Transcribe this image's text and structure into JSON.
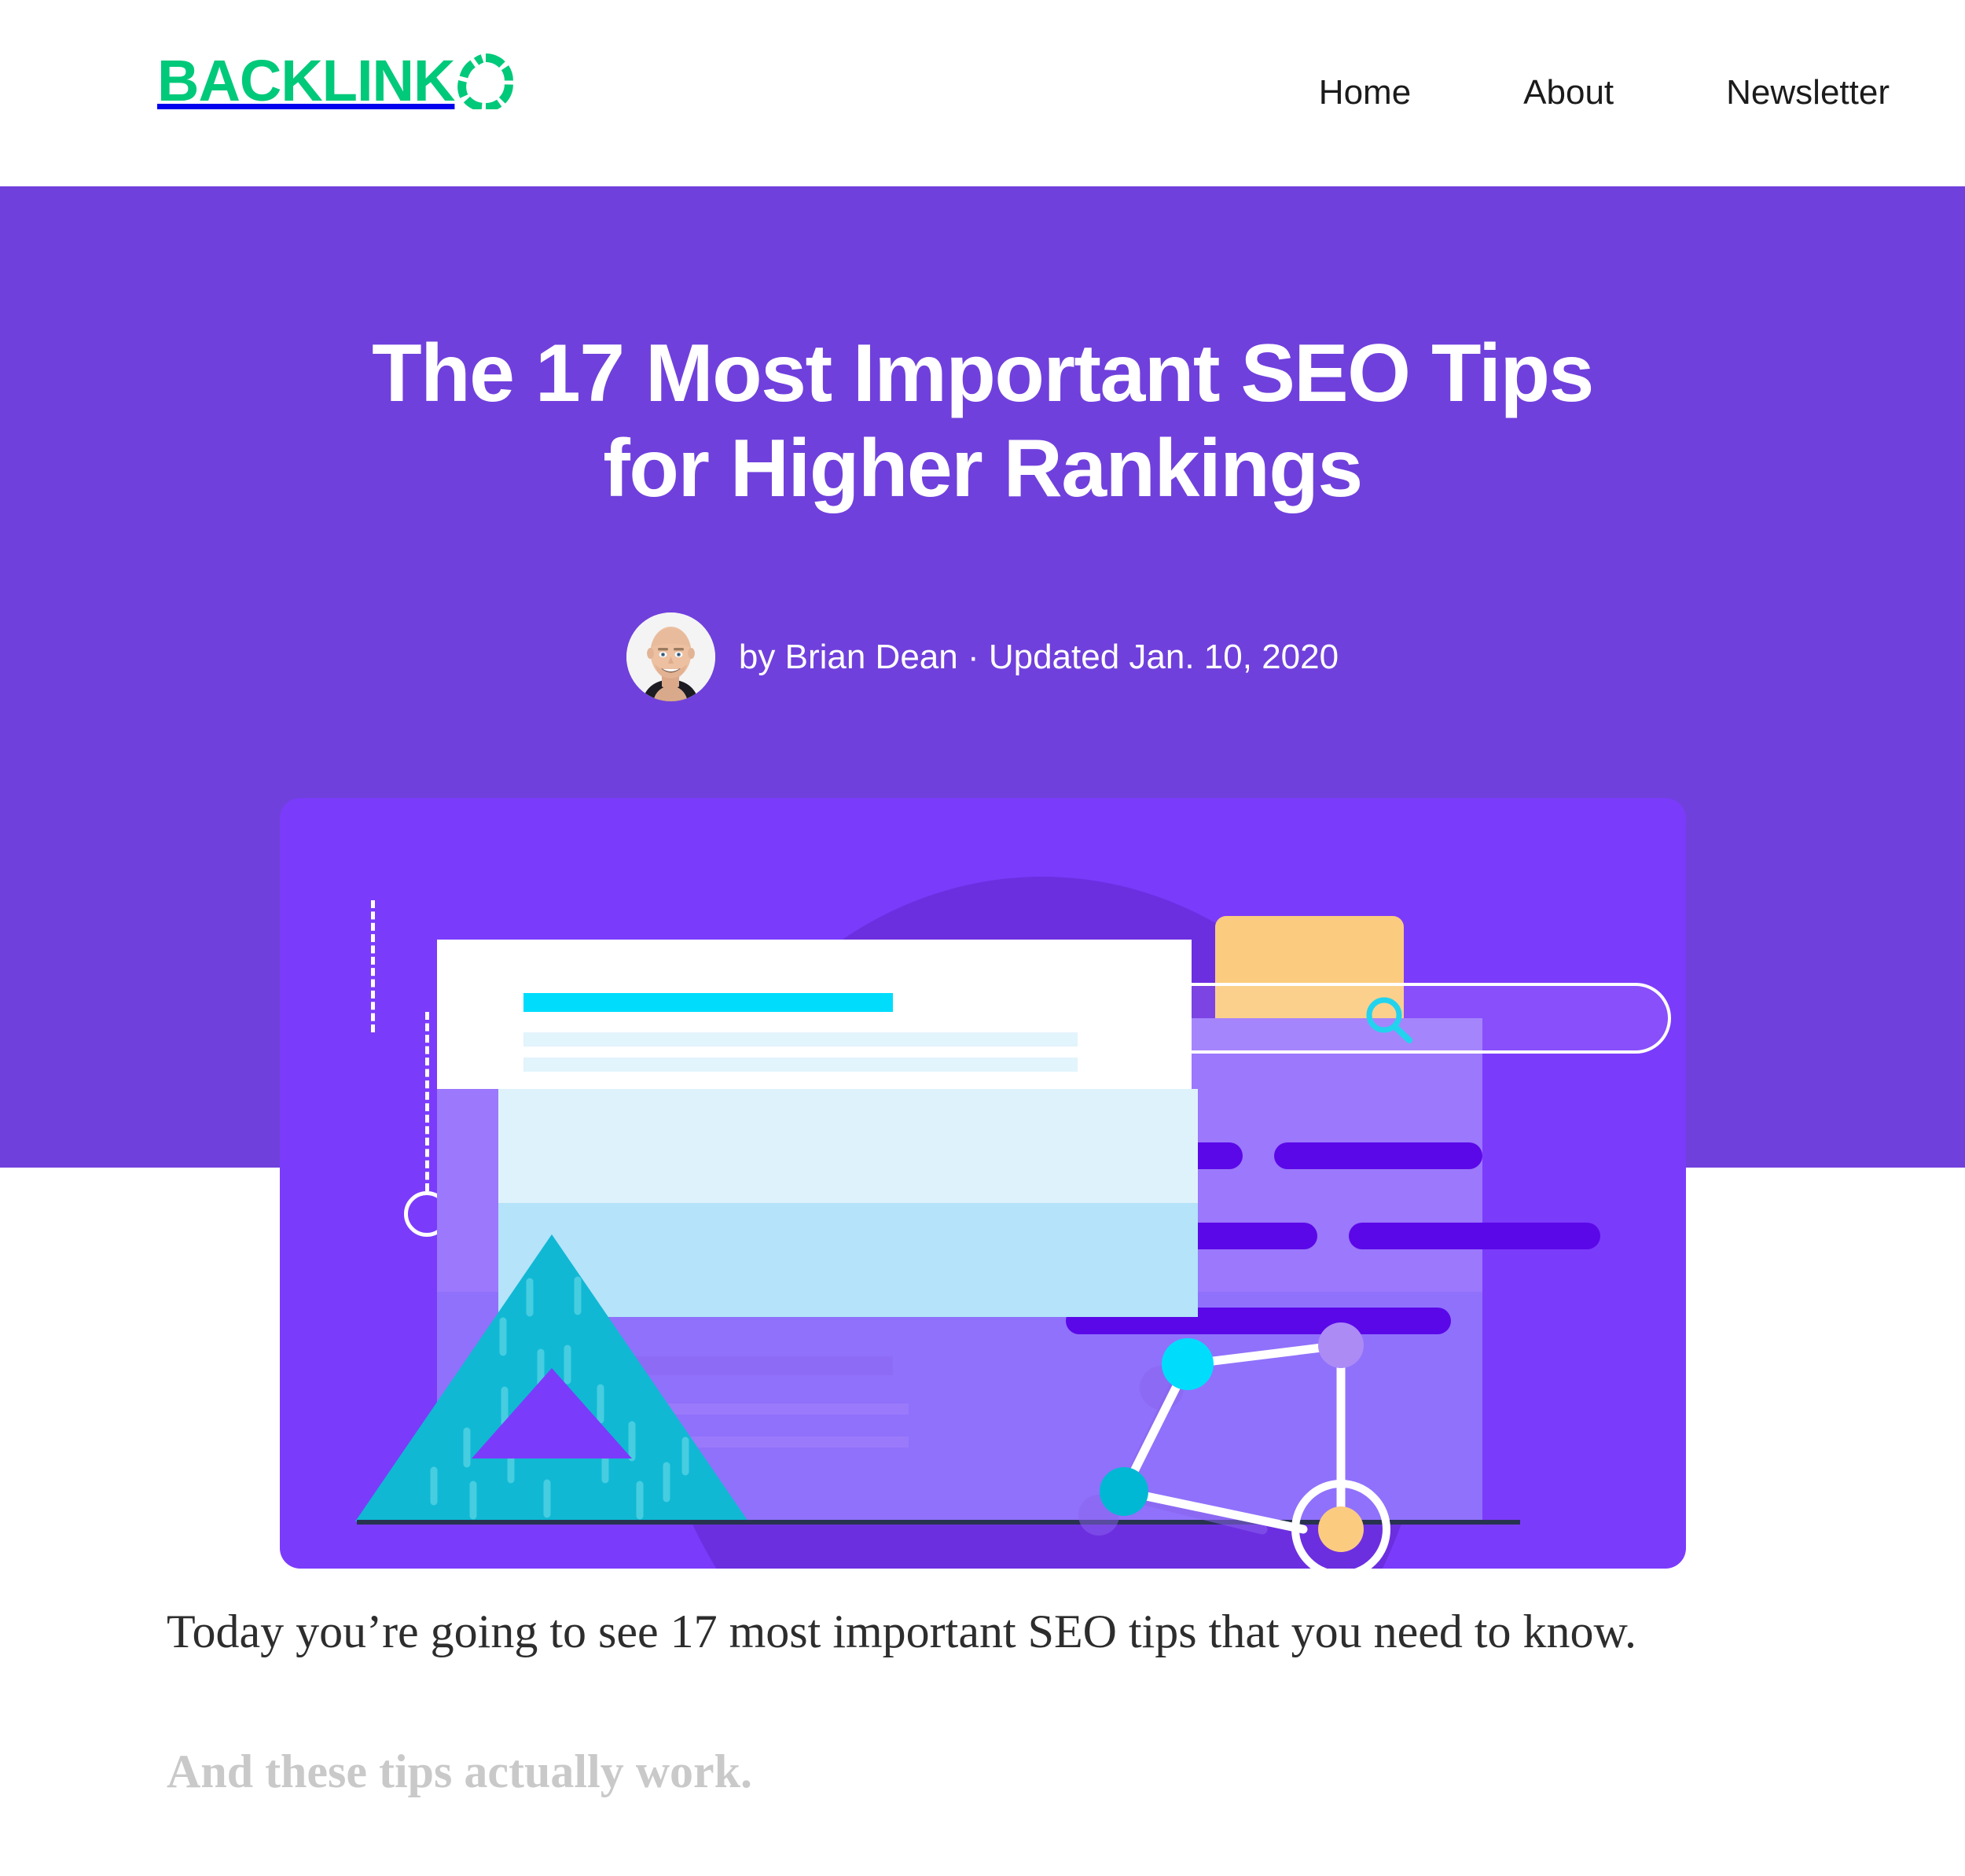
{
  "header": {
    "logo_text": "BACKLINK",
    "logo_o_icon": "segmented-circle-icon",
    "logo_color": "#00C97A",
    "nav": [
      {
        "label": "Home"
      },
      {
        "label": "About"
      },
      {
        "label": "Newsletter"
      }
    ]
  },
  "hero": {
    "background_color": "#7040DC",
    "title_line_1": "The 17 Most Important SEO Tips",
    "title_line_2": "for Higher Rankings",
    "title": "The 17 Most Important SEO Tips for Higher Rankings",
    "byline": "by Brian Dean · Updated Jan. 10, 2020",
    "author_name": "Brian Dean",
    "updated_date": "Jan. 10, 2020",
    "avatar_alt": "Brian Dean headshot"
  },
  "illustration": {
    "card_background": "#7B3BFB",
    "blob_color": "#6C2FE0",
    "accent_cyan": "#00DDFC",
    "accent_teal": "#10B8D4",
    "accent_yellow": "#FBCB80",
    "accent_deep_purple": "#5B08E8",
    "pale_blue": "#B4E3FA",
    "pale_blue_light": "#DEF2FB",
    "lavender": "#9B78FC",
    "ground_color": "#283350",
    "search_icon": "magnifier-icon",
    "node_colors": [
      "#00DDFC",
      "#00B8D4",
      "#AC8BF5",
      "#FBCB80"
    ]
  },
  "article": {
    "paragraph_1": "Today you’re going to see 17 most important SEO tips that you need to know.",
    "paragraph_2": "And these tips actually work."
  }
}
